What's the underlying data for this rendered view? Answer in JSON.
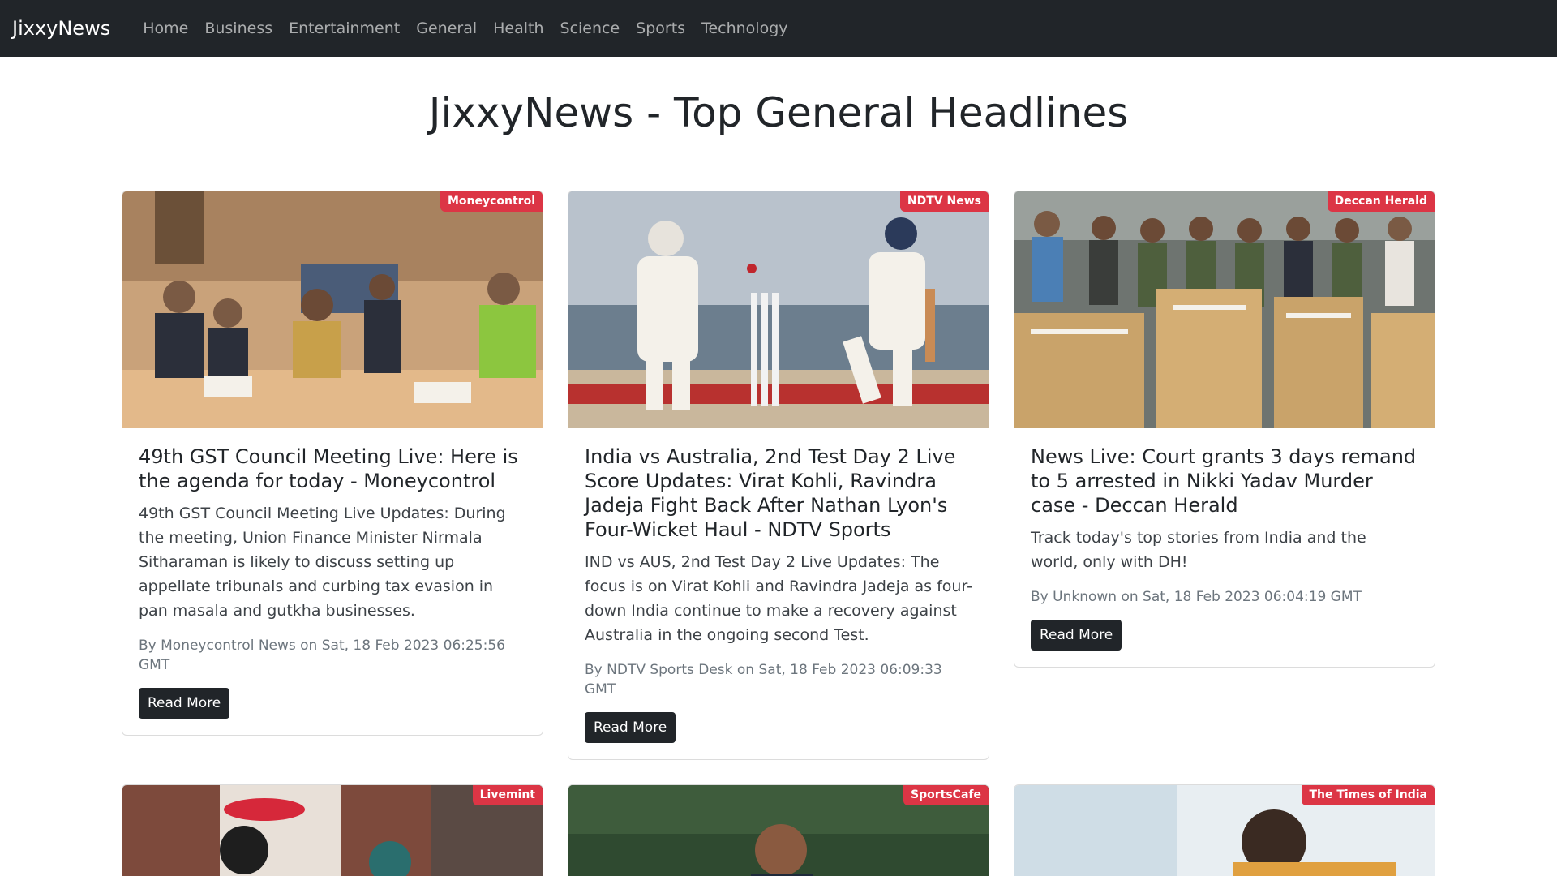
{
  "navbar": {
    "brand": "JixxyNews",
    "links": [
      "Home",
      "Business",
      "Entertainment",
      "General",
      "Health",
      "Science",
      "Sports",
      "Technology"
    ]
  },
  "page": {
    "heading": "JixxyNews - Top General Headlines"
  },
  "cards": [
    {
      "source": "Moneycontrol",
      "title": "49th GST Council Meeting Live: Here is the agenda for today - Moneycontrol",
      "description": "49th GST Council Meeting Live Updates: During the meeting, Union Finance Minister Nirmala Sitharaman is likely to discuss setting up appellate tribunals and curbing tax evasion in pan masala and gutkha businesses.",
      "meta": "By Moneycontrol News on Sat, 18 Feb 2023 06:25:56 GMT",
      "button": "Read More"
    },
    {
      "source": "NDTV News",
      "title": "India vs Australia, 2nd Test Day 2 Live Score Updates: Virat Kohli, Ravindra Jadeja Fight Back After Nathan Lyon's Four-Wicket Haul - NDTV Sports",
      "description": "IND vs AUS, 2nd Test Day 2 Live Updates: The focus is on Virat Kohli and Ravindra Jadeja as four-down India continue to make a recovery against Australia in the ongoing second Test.",
      "meta": "By NDTV Sports Desk on Sat, 18 Feb 2023 06:09:33 GMT",
      "button": "Read More"
    },
    {
      "source": "Deccan Herald",
      "title": "News Live: Court grants 3 days remand to 5 arrested in Nikki Yadav Murder case - Deccan Herald",
      "description": "Track today's top stories from India and the world, only with DH!",
      "meta": "By Unknown on Sat, 18 Feb 2023 06:04:19 GMT",
      "button": "Read More"
    },
    {
      "source": "Livemint"
    },
    {
      "source": "SportsCafe"
    },
    {
      "source": "The Times of India"
    }
  ],
  "colors": {
    "navbar_bg": "#212529",
    "badge_bg": "#dc3545",
    "button_bg": "#212529"
  }
}
